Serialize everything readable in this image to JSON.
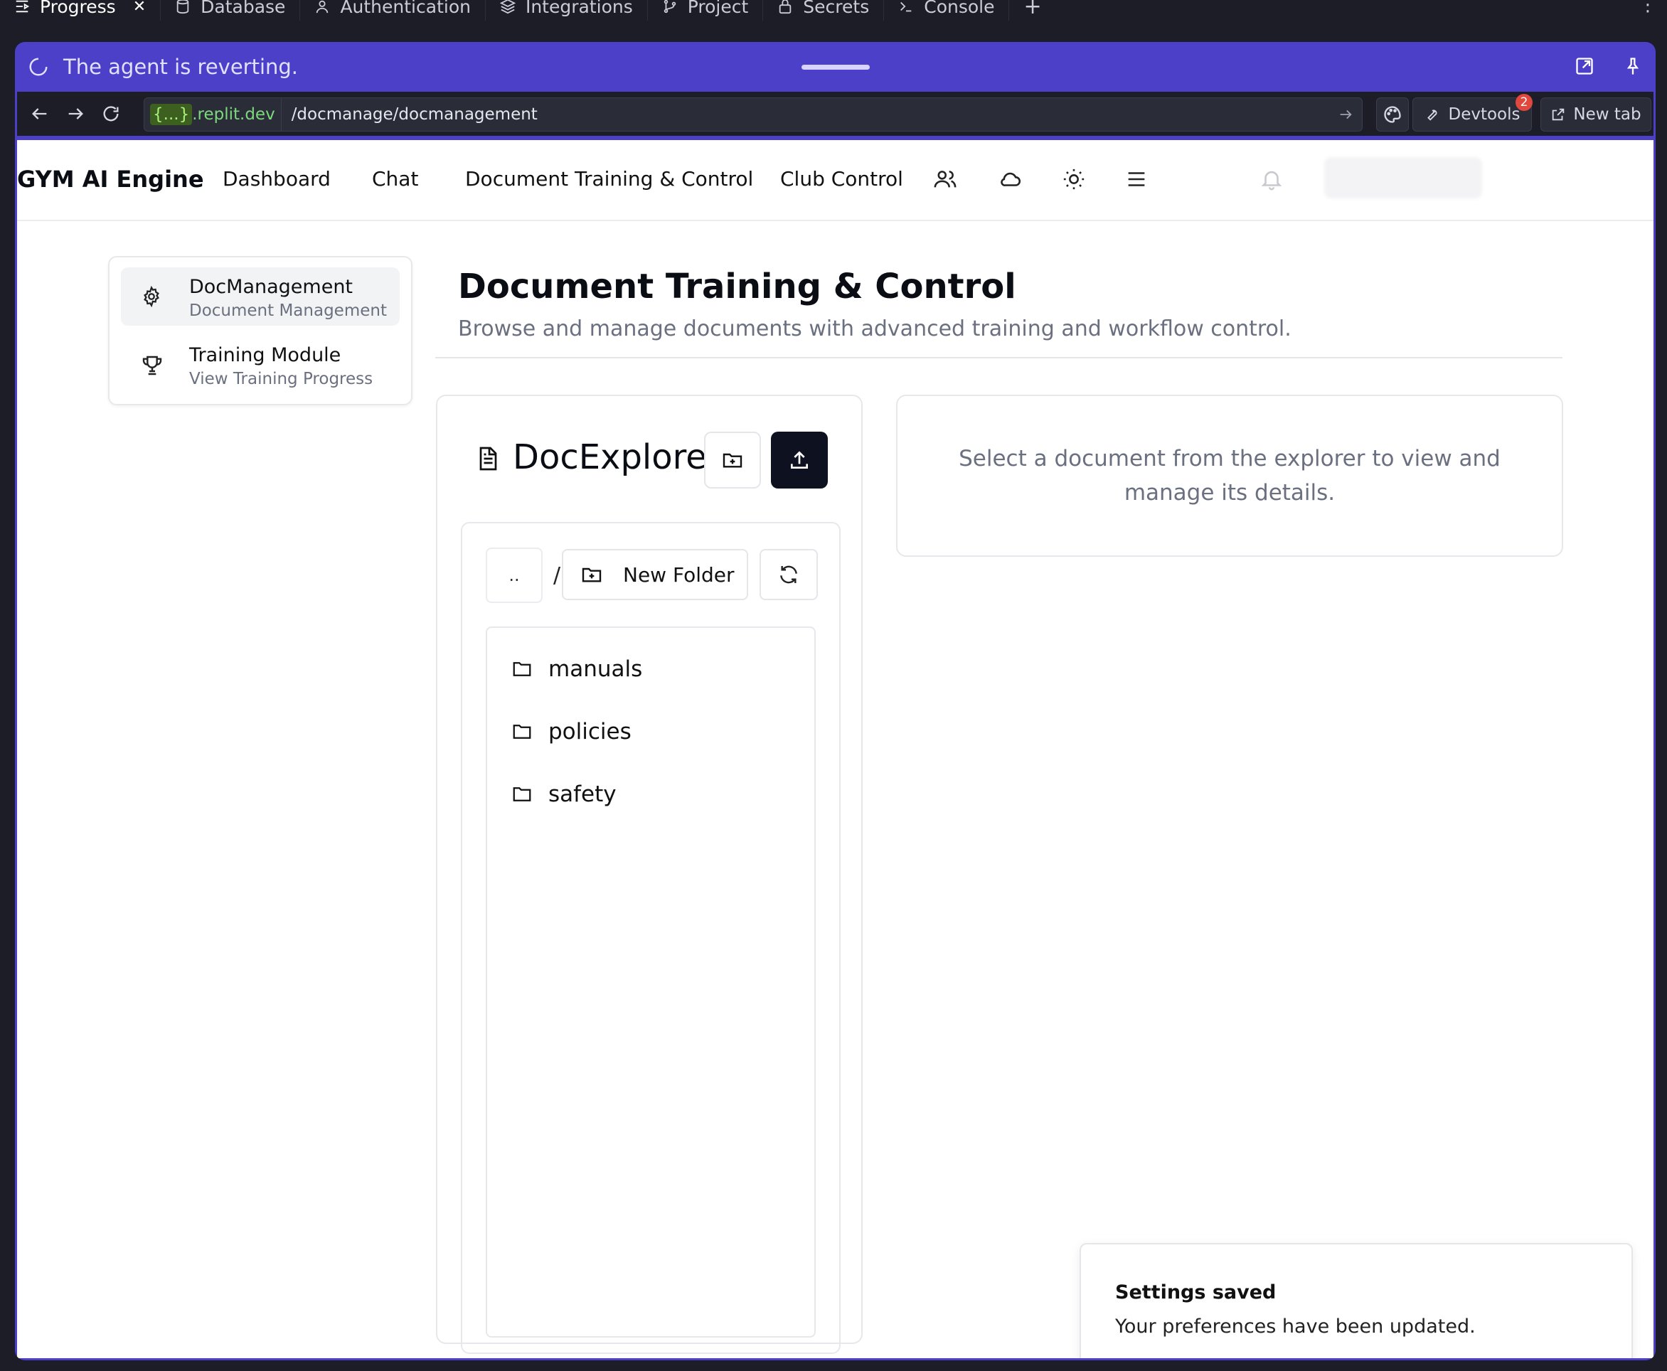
{
  "ide_tabs": [
    {
      "label": "Progress",
      "icon": "progress-icon",
      "active": true
    },
    {
      "label": "Database",
      "icon": "database-icon"
    },
    {
      "label": "Authentication",
      "icon": "user-icon"
    },
    {
      "label": "Integrations",
      "icon": "layers-icon"
    },
    {
      "label": "Project",
      "icon": "git-branch-icon"
    },
    {
      "label": "Secrets",
      "icon": "lock-icon"
    },
    {
      "label": "Console",
      "icon": "terminal-icon"
    }
  ],
  "agent": {
    "status": "The agent is reverting."
  },
  "browser": {
    "host_token": "{...}",
    "host_domain": ".replit.dev",
    "path": "/docmanage/docmanagement",
    "devtools_label": "Devtools",
    "devtools_badge": "2",
    "newtab_label": "New tab"
  },
  "header": {
    "brand": "GYM AI Engine",
    "nav": [
      "Dashboard",
      "Chat",
      "Document Training & Control",
      "Club Control"
    ]
  },
  "sidebar": {
    "items": [
      {
        "title": "DocManagement",
        "subtitle": "Document Management",
        "icon": "gear-icon",
        "active": true
      },
      {
        "title": "Training Module",
        "subtitle": "View Training Progress",
        "icon": "trophy-icon",
        "active": false
      }
    ]
  },
  "main": {
    "title": "Document Training & Control",
    "subtitle": "Browse and manage documents with advanced training and workflow control."
  },
  "explorer": {
    "title": "DocExplorer",
    "up_label": "..",
    "path_separator": "/",
    "new_folder_label": "New Folder",
    "folders": [
      "manuals",
      "policies",
      "safety"
    ]
  },
  "details": {
    "placeholder": "Select a document from the explorer to view and manage its details."
  },
  "toast": {
    "title": "Settings saved",
    "message": "Your preferences have been updated."
  },
  "colors": {
    "agent_bar": "#4c3fc8",
    "ide_background": "#1c1d26",
    "primary_button": "#0e1120",
    "badge": "#e0483e"
  }
}
